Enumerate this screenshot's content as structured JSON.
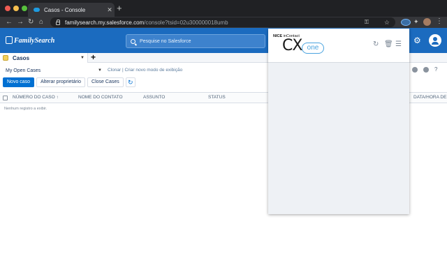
{
  "browser": {
    "tab_title": "Casos - Console",
    "tab_close": "✕",
    "new_tab": "+",
    "url_host": "familysearch.my.salesforce.com",
    "url_path": "/console?tsid=02u300000018umb"
  },
  "icons": {
    "back": "←",
    "forward": "→",
    "reload": "↻",
    "home": "⌂",
    "key": "⚿",
    "star": "☆",
    "puzzle": "✦",
    "kebab": "⋮",
    "gear": "⚙",
    "refresh": "↻",
    "cx_refresh": "↻",
    "trash": "🗑",
    "filter": "☰",
    "caret": "▼",
    "plus": "+"
  },
  "header": {
    "logo_text": "FamilySearch",
    "search_placeholder": "Pesquise no Salesforce"
  },
  "subtab": {
    "label": "Casos"
  },
  "view": {
    "selected": "My Open Cases",
    "links": "Clonar | Criar novo modo de exibição"
  },
  "buttons": {
    "new_case": "Novo caso",
    "change_owner": "Alterar proprietário",
    "close_cases": "Close Cases"
  },
  "grid": {
    "columns": [
      "NÚMERO DO CASO ↑",
      "NOME DO CONTATO",
      "ASSUNTO",
      "STATUS",
      "DATA/HORA DE ABE"
    ],
    "empty_message": "Nenhum registro a exibir."
  },
  "extension": {
    "brand_nice": "NICE",
    "brand_incontact": "inContact",
    "logo_cx": "CX",
    "logo_one": "one"
  },
  "colors": {
    "salesforce_blue": "#1b6bbf",
    "primary_button": "#0070d2",
    "cxone_accent": "#4aa3df"
  }
}
